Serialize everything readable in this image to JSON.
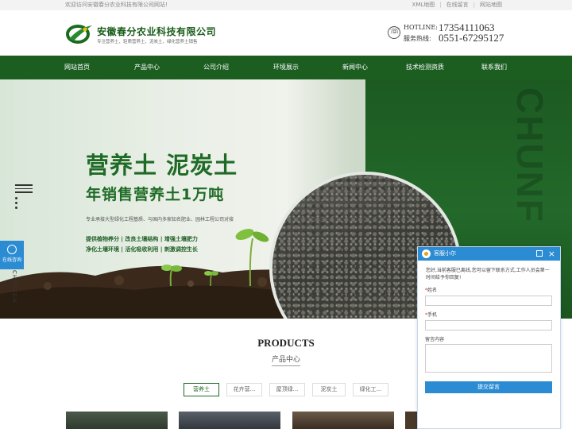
{
  "topbar": {
    "welcome": "欢迎访问安徽春分农业科技有限公司网站!",
    "links": [
      "XML地图",
      "在线留言",
      "网站地图"
    ]
  },
  "header": {
    "company_name": "安徽春分农业科技有限公司",
    "company_sub": "专注营养土、轻质营养土、泥炭土、绿化营养土销售",
    "hotline_label": "HOTLINE:",
    "hotline_number": "17354111063",
    "service_label": "服务热线:",
    "service_number": "0551-67295127"
  },
  "nav": {
    "items": [
      "网站首页",
      "产品中心",
      "公司介绍",
      "环境展示",
      "新闻中心",
      "技术检测资质",
      "联系我们"
    ]
  },
  "banner": {
    "headline": "营养土 泥炭土",
    "subheadline": "年销售营养土1万吨",
    "desc": "专业承接大型绿化工程基质、与国内多家知名肥业、园林工程公司对接",
    "features_line1": "提供植物养分 | 改良土壤结构 | 增强土壤肥力",
    "features_line2": "净化土壤环境 | 活化吸收利用 | 刺激调控生长",
    "watermark": "CHUNF"
  },
  "side": {
    "consult_label": "在线咨询",
    "vertical_text": "CHUNFEN"
  },
  "products": {
    "title": "PRODUCTS",
    "subtitle": "产品中心",
    "tabs": [
      "营养土",
      "花卉营...",
      "屋顶绿...",
      "泥炭土",
      "绿化工..."
    ]
  },
  "chat": {
    "title": "客服小尔",
    "message": "您好,当前客服已离线,您可以留下联系方式,工作人员会第一时间给予你回复!",
    "name_label": "姓名",
    "phone_label": "手机",
    "msg_label": "留言内容",
    "submit_label": "提交留言"
  },
  "colors": {
    "brand_green": "#1b5e20",
    "chat_blue": "#2b8bd3"
  }
}
